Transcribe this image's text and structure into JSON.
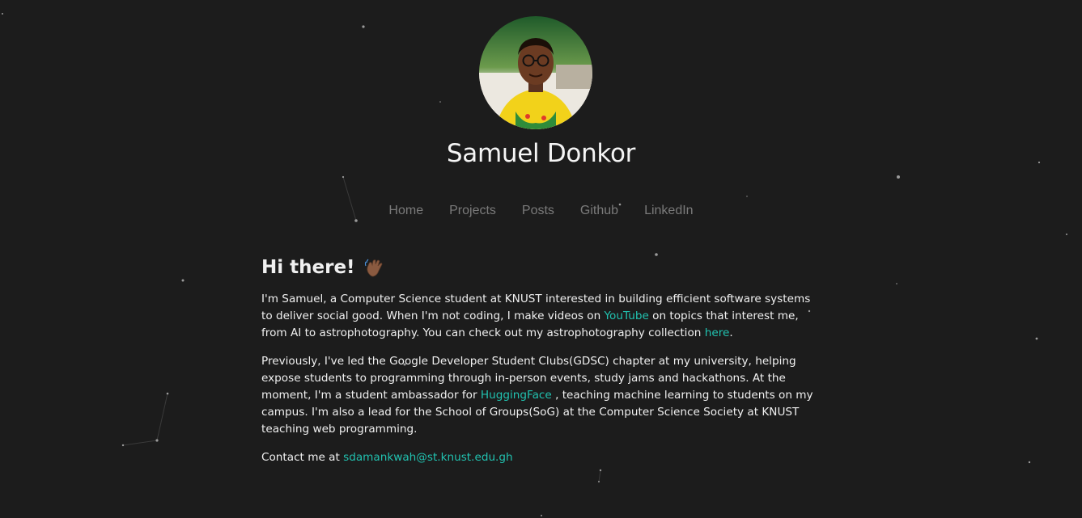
{
  "profile": {
    "name": "Samuel Donkor",
    "avatar_alt": "Samuel Donkor profile photo"
  },
  "nav": {
    "items": [
      {
        "label": "Home"
      },
      {
        "label": "Projects"
      },
      {
        "label": "Posts"
      },
      {
        "label": "Github"
      },
      {
        "label": "LinkedIn"
      }
    ]
  },
  "intro": {
    "greeting": "Hi there!",
    "greeting_icon": "waving-hand-icon",
    "p1_a": "I'm Samuel, a Computer Science student at KNUST interested in building efficient software systems to deliver social good. When I'm not coding, I make videos on ",
    "p1_link1": "YouTube",
    "p1_b": " on topics that interest me, from AI to astrophotography. You can check out my astrophotography collection ",
    "p1_link2": "here",
    "p1_c": ".",
    "p2_a": "Previously, I've led the Google Developer Student Clubs(GDSC) chapter at my university, helping expose students to programming through in-person events, study jams and hackathons. At the moment, I'm a student ambassador for ",
    "p2_link": "HuggingFace",
    "p2_b": " , teaching machine learning to students on my campus. I'm also a lead for the School of Groups(SoG) at the Computer Science Society at KNUST teaching web programming.",
    "contact_prefix": "Contact me at ",
    "contact_email": "sdamankwah@st.knust.edu.gh"
  },
  "colors": {
    "background": "#1c1c1c",
    "link": "#21c2b0",
    "nav": "#7a7a7a",
    "text": "#f0f0f0"
  }
}
